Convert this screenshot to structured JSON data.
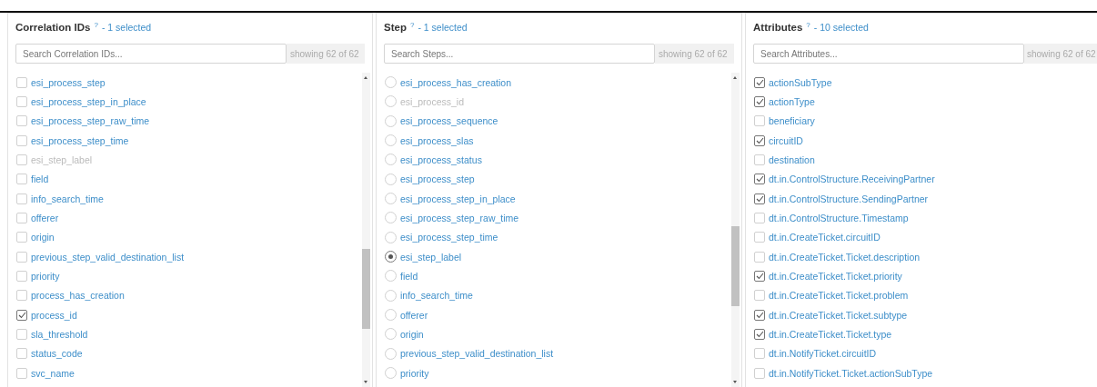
{
  "panels": [
    {
      "title": "Correlation IDs",
      "help": "?",
      "selection": "- 1 selected",
      "search": {
        "placeholder": "Search Correlation IDs..."
      },
      "count": "showing 62 of 62",
      "kind": "checkbox",
      "items": [
        {
          "label": "esi_process_step",
          "checked": false,
          "disabled": false
        },
        {
          "label": "esi_process_step_in_place",
          "checked": false,
          "disabled": false
        },
        {
          "label": "esi_process_step_raw_time",
          "checked": false,
          "disabled": false
        },
        {
          "label": "esi_process_step_time",
          "checked": false,
          "disabled": false
        },
        {
          "label": "esi_step_label",
          "checked": false,
          "disabled": true
        },
        {
          "label": "field",
          "checked": false,
          "disabled": false
        },
        {
          "label": "info_search_time",
          "checked": false,
          "disabled": false
        },
        {
          "label": "offerer",
          "checked": false,
          "disabled": false
        },
        {
          "label": "origin",
          "checked": false,
          "disabled": false
        },
        {
          "label": "previous_step_valid_destination_list",
          "checked": false,
          "disabled": false
        },
        {
          "label": "priority",
          "checked": false,
          "disabled": false
        },
        {
          "label": "process_has_creation",
          "checked": false,
          "disabled": false
        },
        {
          "label": "process_id",
          "checked": true,
          "disabled": false
        },
        {
          "label": "sla_threshold",
          "checked": false,
          "disabled": false
        },
        {
          "label": "status_code",
          "checked": false,
          "disabled": false
        },
        {
          "label": "svc_name",
          "checked": false,
          "disabled": false
        }
      ]
    },
    {
      "title": "Step",
      "help": "?",
      "selection": "- 1 selected",
      "search": {
        "placeholder": "Search Steps..."
      },
      "count": "showing 62 of 62",
      "kind": "radio",
      "items": [
        {
          "label": "esi_process_has_creation",
          "selected": false,
          "disabled": false
        },
        {
          "label": "esi_process_id",
          "selected": false,
          "disabled": true
        },
        {
          "label": "esi_process_sequence",
          "selected": false,
          "disabled": false
        },
        {
          "label": "esi_process_slas",
          "selected": false,
          "disabled": false
        },
        {
          "label": "esi_process_status",
          "selected": false,
          "disabled": false
        },
        {
          "label": "esi_process_step",
          "selected": false,
          "disabled": false
        },
        {
          "label": "esi_process_step_in_place",
          "selected": false,
          "disabled": false
        },
        {
          "label": "esi_process_step_raw_time",
          "selected": false,
          "disabled": false
        },
        {
          "label": "esi_process_step_time",
          "selected": false,
          "disabled": false
        },
        {
          "label": "esi_step_label",
          "selected": true,
          "disabled": false
        },
        {
          "label": "field",
          "selected": false,
          "disabled": false
        },
        {
          "label": "info_search_time",
          "selected": false,
          "disabled": false
        },
        {
          "label": "offerer",
          "selected": false,
          "disabled": false
        },
        {
          "label": "origin",
          "selected": false,
          "disabled": false
        },
        {
          "label": "previous_step_valid_destination_list",
          "selected": false,
          "disabled": false
        },
        {
          "label": "priority",
          "selected": false,
          "disabled": false
        }
      ]
    },
    {
      "title": "Attributes",
      "help": "?",
      "selection": "- 10 selected",
      "search": {
        "placeholder": "Search Attributes..."
      },
      "count": "showing 62 of 62",
      "kind": "checkbox",
      "items": [
        {
          "label": "actionSubType",
          "checked": true,
          "disabled": false
        },
        {
          "label": "actionType",
          "checked": true,
          "disabled": false
        },
        {
          "label": "beneficiary",
          "checked": false,
          "disabled": false
        },
        {
          "label": "circuitID",
          "checked": true,
          "disabled": false
        },
        {
          "label": "destination",
          "checked": false,
          "disabled": false
        },
        {
          "label": "dt.in.ControlStructure.ReceivingPartner",
          "checked": true,
          "disabled": false
        },
        {
          "label": "dt.in.ControlStructure.SendingPartner",
          "checked": true,
          "disabled": false
        },
        {
          "label": "dt.in.ControlStructure.Timestamp",
          "checked": false,
          "disabled": false
        },
        {
          "label": "dt.in.CreateTicket.circuitID",
          "checked": false,
          "disabled": false
        },
        {
          "label": "dt.in.CreateTicket.Ticket.description",
          "checked": false,
          "disabled": false
        },
        {
          "label": "dt.in.CreateTicket.Ticket.priority",
          "checked": true,
          "disabled": false
        },
        {
          "label": "dt.in.CreateTicket.Ticket.problem",
          "checked": false,
          "disabled": false
        },
        {
          "label": "dt.in.CreateTicket.Ticket.subtype",
          "checked": true,
          "disabled": false
        },
        {
          "label": "dt.in.CreateTicket.Ticket.type",
          "checked": true,
          "disabled": false
        },
        {
          "label": "dt.in.NotifyTicket.circuitID",
          "checked": false,
          "disabled": false
        },
        {
          "label": "dt.in.NotifyTicket.Ticket.actionSubType",
          "checked": false,
          "disabled": false
        }
      ]
    }
  ]
}
